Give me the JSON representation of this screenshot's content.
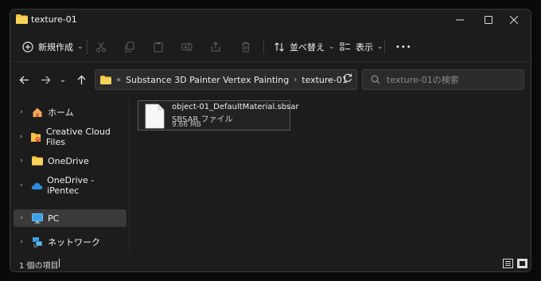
{
  "window": {
    "title": "texture-01"
  },
  "toolbar": {
    "new_label": "新規作成",
    "sort_label": "並べ替え",
    "view_label": "表示",
    "more_label": "•••"
  },
  "address": {
    "overflow": "«",
    "crumbs": [
      "Substance 3D Painter Vertex Painting",
      "texture-01"
    ]
  },
  "search": {
    "placeholder": "texture-01の検索"
  },
  "sidebar": {
    "items": [
      {
        "label": "ホーム",
        "icon": "home-icon"
      },
      {
        "label": "Creative Cloud Files",
        "icon": "creative-cloud-folder-icon"
      },
      {
        "label": "OneDrive",
        "icon": "folder-icon"
      },
      {
        "label": "OneDrive - iPentec",
        "icon": "cloud-icon"
      },
      {
        "label": "PC",
        "icon": "pc-icon"
      },
      {
        "label": "ネットワーク",
        "icon": "network-icon"
      }
    ]
  },
  "files": [
    {
      "name": "object-01_DefaultMaterial.sbsar",
      "type": "SBSAR ファイル",
      "size": "9.66 MB"
    }
  ],
  "status": {
    "count": "1 個の項目"
  },
  "colors": {
    "folder": "#f4c542",
    "accent": "#4cc2ff",
    "background": "#1c1c1c"
  }
}
